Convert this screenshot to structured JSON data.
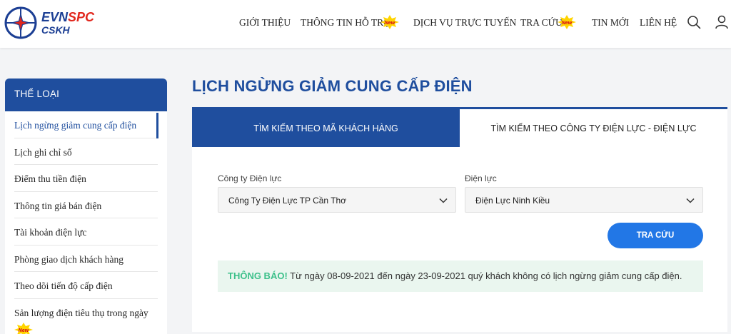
{
  "brand": {
    "name_part1": "EVN",
    "name_part2": "SPC",
    "sub": "CSKH"
  },
  "nav": {
    "items": [
      {
        "label": "GIỚI THIỆU",
        "new": false
      },
      {
        "label": "THÔNG TIN HỖ TRỢ",
        "new": true
      },
      {
        "label": "DỊCH VỤ TRỰC TUYẾN",
        "new": false
      },
      {
        "label": "TRA CỨU",
        "new": true
      },
      {
        "label": "TIN MỚI",
        "new": false
      },
      {
        "label": "LIÊN HỆ",
        "new": false
      }
    ],
    "new_badge_text": "New"
  },
  "sidebar": {
    "title": "THỂ LOẠI",
    "items": [
      {
        "label": "Lịch ngừng giảm cung cấp điện",
        "active": true
      },
      {
        "label": "Lịch ghi chỉ số"
      },
      {
        "label": "Điểm thu tiền điện"
      },
      {
        "label": "Thông tin giá bán điện"
      },
      {
        "label": "Tài khoản điện lực"
      },
      {
        "label": "Phòng giao dịch khách hàng"
      },
      {
        "label": "Theo dõi tiến độ cấp điện"
      },
      {
        "label": "Sản lượng điện tiêu thụ trong ngày",
        "new": true
      }
    ]
  },
  "main": {
    "title": "LỊCH NGỪNG GIẢM CUNG CẤP ĐIỆN",
    "tabs": [
      {
        "label": "TÌM KIẾM THEO MÃ KHÁCH HÀNG",
        "active": true
      },
      {
        "label": "TÌM KIẾM THEO CÔNG TY ĐIỆN LỰC - ĐIỆN LỰC",
        "active": false
      }
    ],
    "company_label": "Công ty Điện lực",
    "company_value": "Công Ty Điện Lực TP Cần Thơ",
    "district_label": "Điện lực",
    "district_value": "Điện Lực Ninh Kiều",
    "search_button": "TRA CỨU",
    "notice_label": "THÔNG BÁO!",
    "notice_text": " Từ ngày 08-09-2021 đến ngày 23-09-2021 quý khách không có lịch ngừng giảm cung cấp điện."
  },
  "colors": {
    "primary": "#1f4e9e",
    "button": "#2277e6",
    "notice_bg": "#eaf6ef",
    "notice_label": "#3cc08a",
    "brand_red": "#e1261c"
  }
}
